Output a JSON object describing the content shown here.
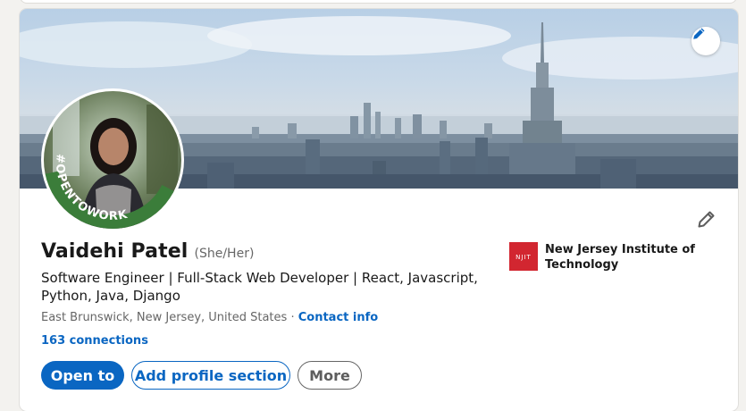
{
  "profile": {
    "name": "Vaidehi Patel",
    "pronouns": "(She/Her)",
    "headline": "Software Engineer | Full-Stack Web Developer | React, Javascript, Python, Java, Django",
    "location": "East Brunswick, New Jersey, United States",
    "separator": "·",
    "contact_info_label": "Contact info",
    "connections_label": "163 connections",
    "open_to_work_badge": "#OPENTOWORK"
  },
  "education": {
    "school_name": "New Jersey Institute of Technology",
    "logo_text": "NJIT"
  },
  "actions": {
    "open_to_label": "Open to",
    "add_section_label": "Add profile section",
    "more_label": "More"
  },
  "icons": {
    "banner_edit": "pencil-icon",
    "profile_edit": "pencil-icon"
  },
  "colors": {
    "accent": "#0a66c2",
    "open_to_work_green": "#3b7d3a",
    "school_logo_red": "#d22630",
    "text_primary": "#191919",
    "text_secondary": "#666666"
  }
}
